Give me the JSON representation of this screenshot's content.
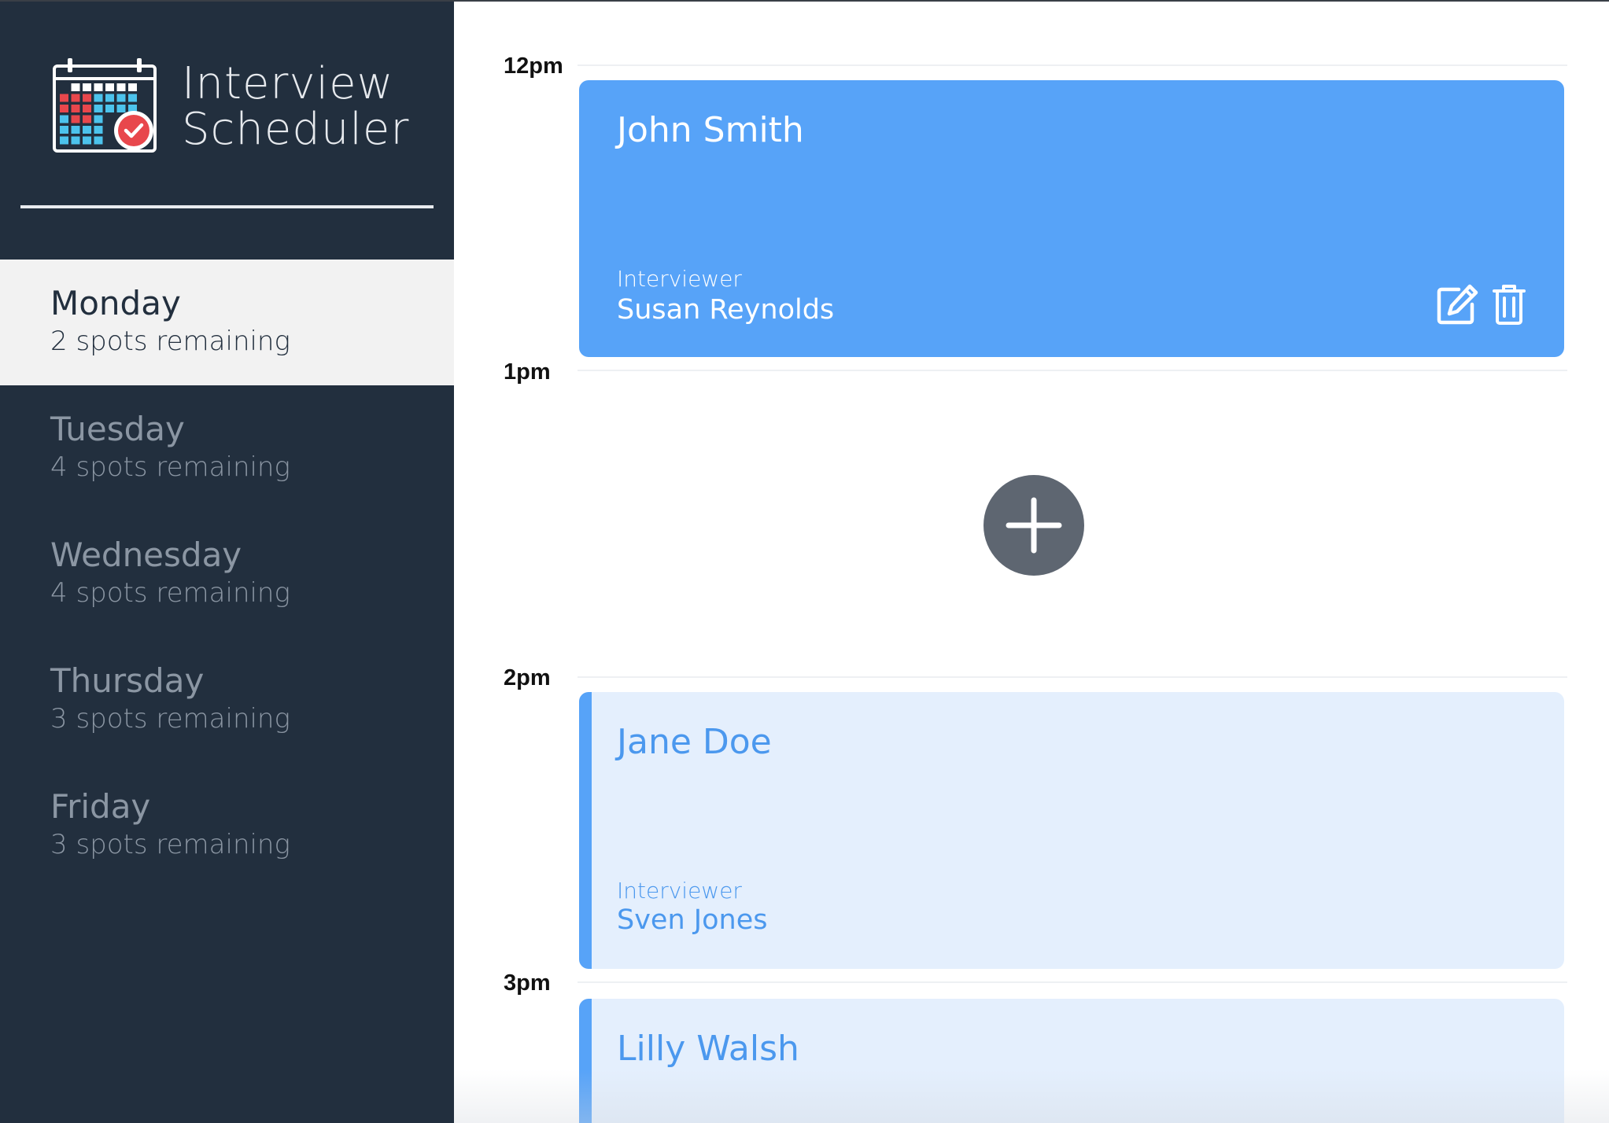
{
  "brand": {
    "title_line1": "Interview",
    "title_line2": "Scheduler",
    "logo_icon": "calendar-check-icon",
    "colors": {
      "grid_blue": "#4cc3ec",
      "grid_red": "#e8474c",
      "check_red": "#e8474c"
    }
  },
  "sidebar": {
    "days": [
      {
        "name": "Monday",
        "spots": "2 spots remaining",
        "selected": true
      },
      {
        "name": "Tuesday",
        "spots": "4 spots remaining",
        "selected": false
      },
      {
        "name": "Wednesday",
        "spots": "4 spots remaining",
        "selected": false
      },
      {
        "name": "Thursday",
        "spots": "3 spots remaining",
        "selected": false
      },
      {
        "name": "Friday",
        "spots": "3 spots remaining",
        "selected": false
      }
    ]
  },
  "schedule": {
    "hours": [
      "12pm",
      "1pm",
      "2pm",
      "3pm"
    ],
    "appointments": [
      {
        "student": "John Smith",
        "interviewer_label": "Interviewer",
        "interviewer": "Susan Reynolds",
        "state": "selected",
        "actions": [
          "edit-icon",
          "trash-icon"
        ]
      },
      {
        "student": "Jane Doe",
        "interviewer_label": "Interviewer",
        "interviewer": "Sven Jones",
        "state": "normal"
      },
      {
        "student": "Lilly Walsh",
        "state": "normal"
      }
    ],
    "add_button_icon": "plus-icon"
  },
  "colors": {
    "sidebar_bg": "#222f3e",
    "selected_day_bg": "#f2f2f2",
    "accent_blue": "#57a3f8",
    "appointment_light_bg": "#e4effd",
    "add_button_bg": "#5e6671"
  }
}
